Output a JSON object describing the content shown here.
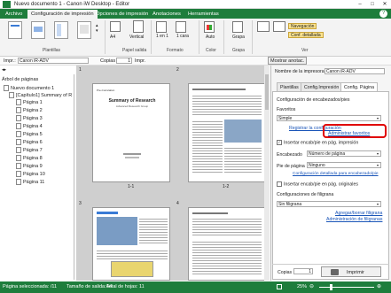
{
  "window": {
    "title": "Nuevo documento 1 - Canon iW Desktop - Editor",
    "minimize": "–",
    "maximize": "□",
    "close": "✕"
  },
  "menu": {
    "tabs": [
      "Archivo",
      "Configuración de impresión",
      "Opciones de impresión",
      "Anotaciones",
      "Herramientas"
    ]
  },
  "ribbon": {
    "groups": [
      "Plantillas",
      "Papel salida",
      "Formato",
      "Color",
      "Grapa",
      "Ver"
    ],
    "paper_size": "A4",
    "orientation": "Vertical",
    "layout": "1 en 1",
    "sides": "1 cara",
    "color": "Auto",
    "staple": "Grapa",
    "view_navigation": "Navegación",
    "view_detailed": "Conf. detallada"
  },
  "toolbar": {
    "printer_label": "Impr.:",
    "printer_value": "Canon iR-ADV",
    "copies_label": "Copias",
    "copies_value": "1",
    "print_btn": "Impr.",
    "show_annot": "Mostrar anotac."
  },
  "tree": {
    "header": "Árbol de páginas",
    "root": "Nuevo documento 1",
    "chapter": "[Capítulo1] Summary of R",
    "pages": [
      "Página 1",
      "Página 2",
      "Página 3",
      "Página 4",
      "Página 5",
      "Página 6",
      "Página 7",
      "Página 8",
      "Página 9",
      "Página 10",
      "Página 11"
    ]
  },
  "preview": {
    "sheet_numbers": [
      "1",
      "2",
      "3",
      "4"
    ],
    "page_labels": [
      "1-1",
      "1-2"
    ],
    "page1_title": "Summary of Research",
    "page1_sub": "Advanced Research Group"
  },
  "rpanel": {
    "printer_name_label": "Nombre de la impresora",
    "printer_name_value": "Canon iR-ADV",
    "tabs": [
      "Plantillas",
      "Config.Impresión",
      "Config. Página"
    ],
    "header_footer_title": "Configuración de encabezados/pies",
    "favorites_label": "Favoritos",
    "favorites_value": "Simple",
    "register_link": "Registrar la configuración",
    "manage_link": "Administrar favoritos",
    "insert_hf_label": "Insertar encab/pie en pág. impresión",
    "header_label": "Encabezado",
    "header_value": "Número de página",
    "footer_label": "Pie de página",
    "footer_value": "Ninguno",
    "detail_link": "Configuración detallada para encabezado/pie",
    "insert_orig_label": "Insertar encab/pie en pág. originales",
    "watermark_title": "Configuraciones de filigrana",
    "watermark_value": "Sin filigrana",
    "add_wm_link": "Agregar/borrar filigrana",
    "admin_wm_link": "Administración de filigranas",
    "copies_label": "Copias",
    "copies_value": "1",
    "print_button": "Imprimir"
  },
  "status": {
    "selected": "Página seleccionada: /11",
    "output_size": "Tamaño de salida:A4",
    "total": "Total de hojas: 11",
    "zoom": "25%"
  },
  "colors": {
    "accent": "#1e7d3c",
    "highlight": "#e00000",
    "link": "#1a55b8"
  }
}
